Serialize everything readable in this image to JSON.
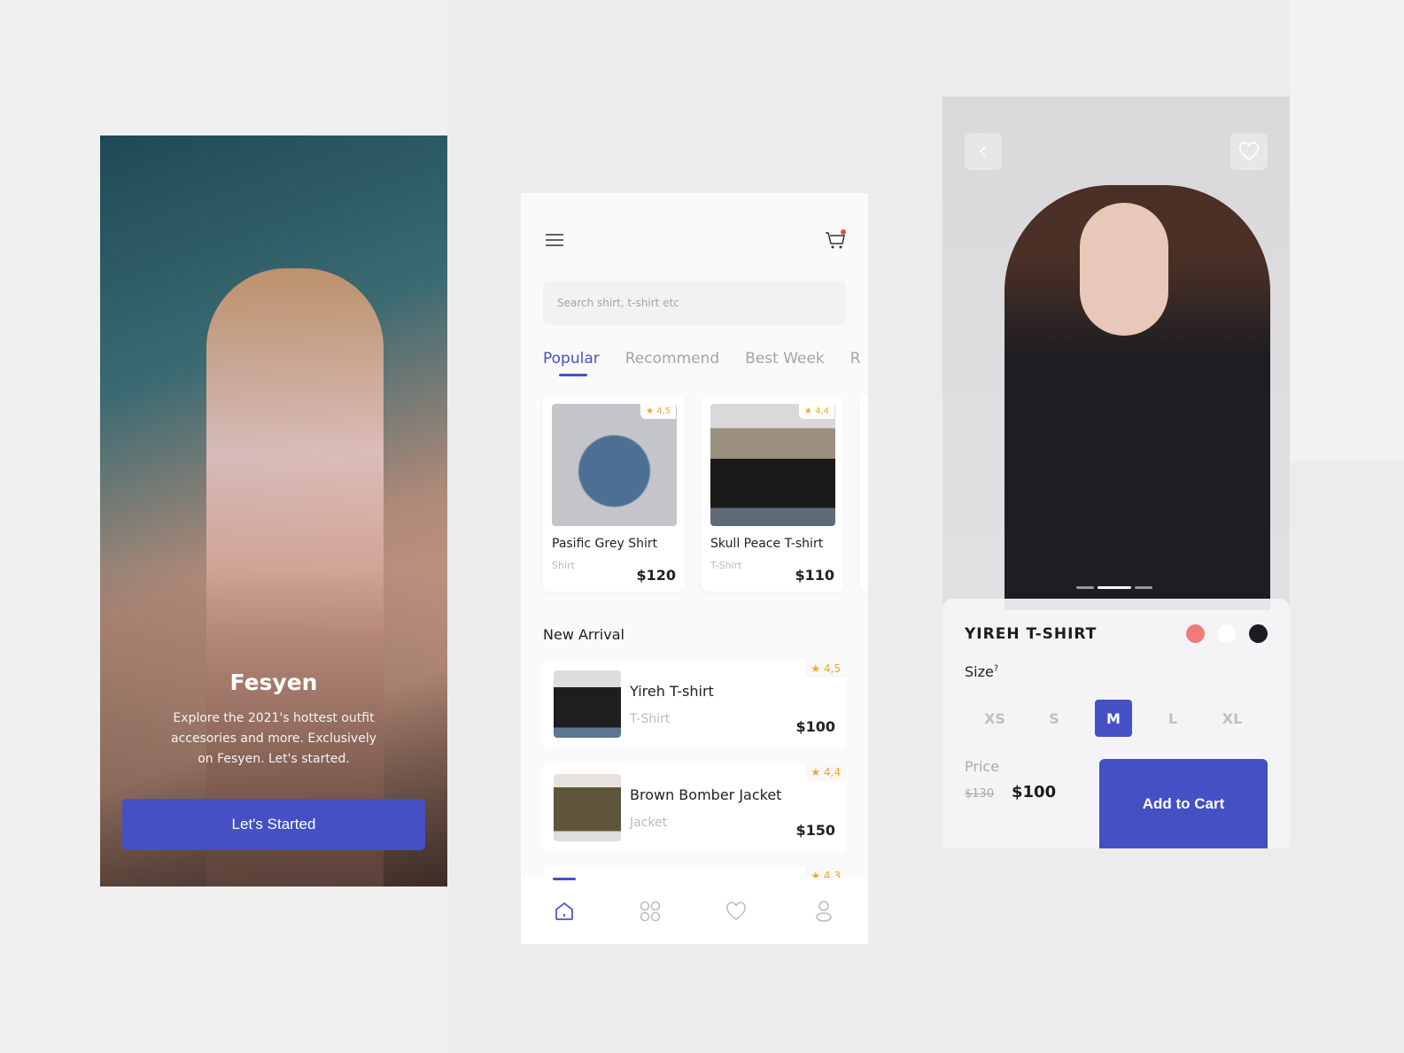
{
  "onboarding": {
    "title": "Fesyen",
    "description": "Explore the 2021's hottest outfit accesories and more. Exclusively on Fesyen. Let's started.",
    "button": "Let's Started"
  },
  "home": {
    "search_placeholder": "Search shirt, t-shirt etc",
    "tabs": [
      "Popular",
      "Recommend",
      "Best Week",
      "R"
    ],
    "popular": [
      {
        "name": "Pasific Grey Shirt",
        "category": "Shirt",
        "price": "$120",
        "rating": "4,5"
      },
      {
        "name": "Skull Peace T-shirt",
        "category": "T-Shirt",
        "price": "$110",
        "rating": "4,4"
      }
    ],
    "section_title": "New Arrival",
    "arrivals": [
      {
        "name": "Yireh T-shirt",
        "category": "T-Shirt",
        "price": "$100",
        "rating": "4,5"
      },
      {
        "name": "Brown Bomber Jacket",
        "category": "Jacket",
        "price": "$150",
        "rating": "4,4"
      },
      {
        "rating": "4,3"
      }
    ],
    "nav": [
      "home-icon",
      "grid-icon",
      "heart-icon",
      "user-icon"
    ]
  },
  "detail": {
    "title": "YIREH T-SHIRT",
    "colors": [
      "#ef7b7b",
      "#ffffff",
      "#1b1b20"
    ],
    "size_label": "Size",
    "size_hint": "?",
    "sizes": [
      "XS",
      "S",
      "M",
      "L",
      "XL"
    ],
    "selected_size": "M",
    "price_label": "Price",
    "old_price": "$130",
    "price": "$100",
    "button": "Add to Cart",
    "image_page": 2,
    "image_pages": 3
  },
  "colors": {
    "accent": "#4450c4",
    "star": "#f6a623"
  }
}
